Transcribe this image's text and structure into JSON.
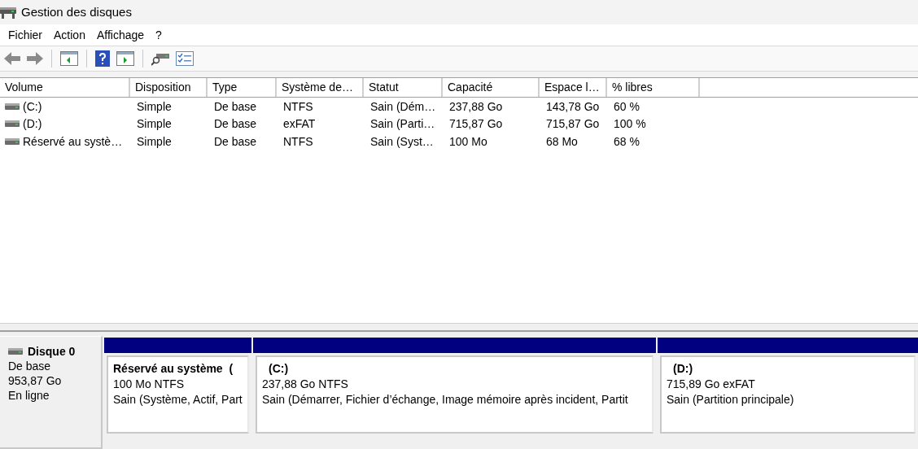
{
  "window": {
    "title": "Gestion des disques"
  },
  "menu": [
    "Fichier",
    "Action",
    "Affichage",
    "?"
  ],
  "table": {
    "columns": [
      "Volume",
      "Disposition",
      "Type",
      "Système de…",
      "Statut",
      "Capacité",
      "Espace l…",
      "% libres"
    ],
    "rows": [
      {
        "cells": [
          "(C:)",
          "Simple",
          "De base",
          "NTFS",
          "Sain (Dém…",
          "237,88 Go",
          "143,78 Go",
          "60 %"
        ]
      },
      {
        "cells": [
          "(D:)",
          "Simple",
          "De base",
          "exFAT",
          "Sain (Parti…",
          "715,87 Go",
          "715,87 Go",
          "100 %"
        ]
      },
      {
        "cells": [
          "Réservé au systè…",
          "Simple",
          "De base",
          "NTFS",
          "Sain (Syst…",
          "100 Mo",
          "68 Mo",
          "68 %"
        ]
      }
    ]
  },
  "disk": {
    "name": "Disque 0",
    "type": "De base",
    "size": "953,87 Go",
    "state": "En ligne",
    "partitions": [
      {
        "name": "Réservé au système  (",
        "detail": "100 Mo NTFS",
        "status": "Sain (Système, Actif, Part"
      },
      {
        "name": "(C:)",
        "detail": "237,88 Go NTFS",
        "status": "Sain (Démarrer, Fichier d’échange, Image mémoire après incident, Partit"
      },
      {
        "name": "(D:)",
        "detail": "715,89 Go exFAT",
        "status": "Sain (Partition principale)"
      }
    ]
  }
}
